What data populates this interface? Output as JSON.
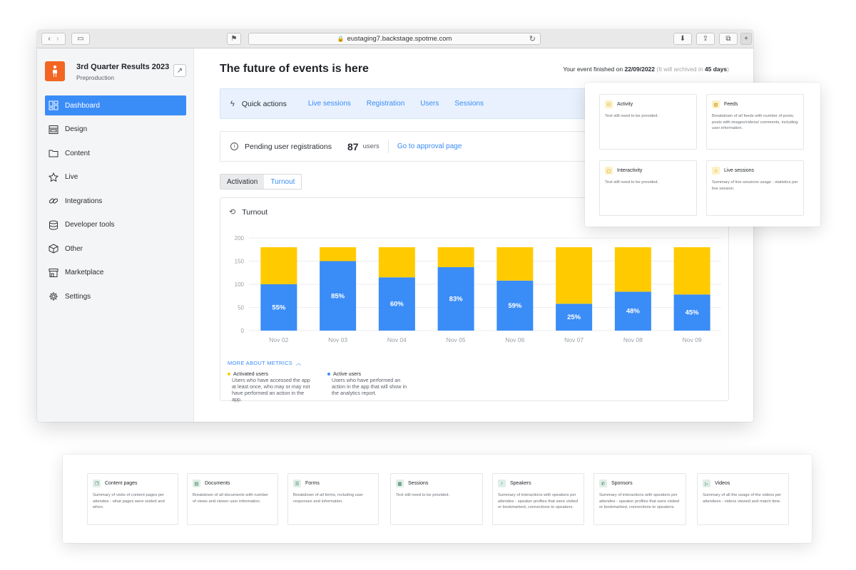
{
  "browser": {
    "url": "eustaging7.backstage.spotme.com"
  },
  "event": {
    "title": "3rd Quarter Results 2023",
    "subtitle": "Preproduction"
  },
  "sidebar": {
    "items": [
      {
        "label": "Dashboard",
        "icon": "dashboard-icon"
      },
      {
        "label": "Design",
        "icon": "design-icon"
      },
      {
        "label": "Content",
        "icon": "folder-icon"
      },
      {
        "label": "Live",
        "icon": "star-icon"
      },
      {
        "label": "Integrations",
        "icon": "link-icon"
      },
      {
        "label": "Developer tools",
        "icon": "database-icon"
      },
      {
        "label": "Other",
        "icon": "cube-icon"
      },
      {
        "label": "Marketplace",
        "icon": "store-icon"
      },
      {
        "label": "Settings",
        "icon": "gear-icon"
      }
    ]
  },
  "main": {
    "title": "The future of events is here",
    "finished_prefix": "Your event finished on",
    "finished_date": "22/09/2022",
    "archive_note_prefix": "(It will archived in",
    "archive_days": "45 days",
    "archive_note_suffix": ")"
  },
  "quick_actions": {
    "label": "Quick actions",
    "links": [
      "Live sessions",
      "Registration",
      "Users",
      "Sessions"
    ]
  },
  "pending": {
    "label": "Pending user registrations",
    "count": "87",
    "unit": "users",
    "link": "Go to approval page"
  },
  "tabs": {
    "activation": "Activation",
    "turnout": "Turnout"
  },
  "turnout": {
    "title": "Turnout",
    "metrics_link": "MORE ABOUT METRICS",
    "legend": [
      {
        "title": "Activated users",
        "desc": "Users who have accessed the app at least once, who may or may not have performed an action in the app.",
        "color": "#ffcb00"
      },
      {
        "title": "Active users",
        "desc": "Users who have performed an action in the app that will show in the analytics report.",
        "color": "#3a8cf7"
      }
    ]
  },
  "chart_data": {
    "type": "bar",
    "stacked": true,
    "categories": [
      "Nov 02",
      "Nov 03",
      "Nov 04",
      "Nov 05",
      "Nov 06",
      "Nov 07",
      "Nov 08",
      "Nov 09"
    ],
    "series": [
      {
        "name": "Active users",
        "color": "#3a8cf7",
        "values": [
          100,
          150,
          115,
          137,
          108,
          58,
          84,
          78
        ]
      },
      {
        "name": "Activated users",
        "color": "#ffcb00",
        "values": [
          80,
          30,
          65,
          43,
          72,
          122,
          96,
          102
        ]
      }
    ],
    "data_labels": [
      "55%",
      "85%",
      "60%",
      "83%",
      "59%",
      "25%",
      "48%",
      "45%"
    ],
    "y_ticks": [
      0,
      50,
      100,
      150,
      200
    ],
    "ylim": [
      0,
      200
    ],
    "grid": true
  },
  "panel_right": {
    "cards": [
      {
        "title": "Activity",
        "desc": "Text still need to be provided.",
        "icon": "users-icon",
        "tone": "yellow"
      },
      {
        "title": "Feeds",
        "desc": "Breakdown of all feeds with number of posts, posts with images/videos/ comments, including user information.",
        "icon": "feed-icon",
        "tone": "yellow"
      },
      {
        "title": "Interactivity",
        "desc": "Text still need to be provided.",
        "icon": "chat-icon",
        "tone": "yellow"
      },
      {
        "title": "Live sessions",
        "desc": "Summary of live sessions usage - statistics per live session.",
        "icon": "star-icon",
        "tone": "yellow"
      }
    ]
  },
  "panel_bottom": {
    "cards": [
      {
        "title": "Content pages",
        "desc": "Summary of visits of content pages per attendee - what pages were visited and when.",
        "icon": "pages-icon",
        "tone": "green"
      },
      {
        "title": "Documents",
        "desc": "Breakdown of all documents with number of views and viewer user information.",
        "icon": "document-icon",
        "tone": "green"
      },
      {
        "title": "Forms",
        "desc": "Breakdown of all forms, including user responses and information.",
        "icon": "form-icon",
        "tone": "green"
      },
      {
        "title": "Sessions",
        "desc": "Text still need to be provided.",
        "icon": "calendar-icon",
        "tone": "green"
      },
      {
        "title": "Speakers",
        "desc": "Summary of interactions with speakers per attendee - speaker profiles that were visited or bookmarked, connections to speakers.",
        "icon": "microphone-icon",
        "tone": "green"
      },
      {
        "title": "Sponsors",
        "desc": "Summary of interactions with speakers per attendee - speaker profiles that were visited or bookmarked, connections to speakers.",
        "icon": "sponsor-icon",
        "tone": "green"
      },
      {
        "title": "Videos",
        "desc": "Summary of all the usage of the videos per attendees - videos viewed and match time.",
        "icon": "video-icon",
        "tone": "green"
      }
    ]
  }
}
